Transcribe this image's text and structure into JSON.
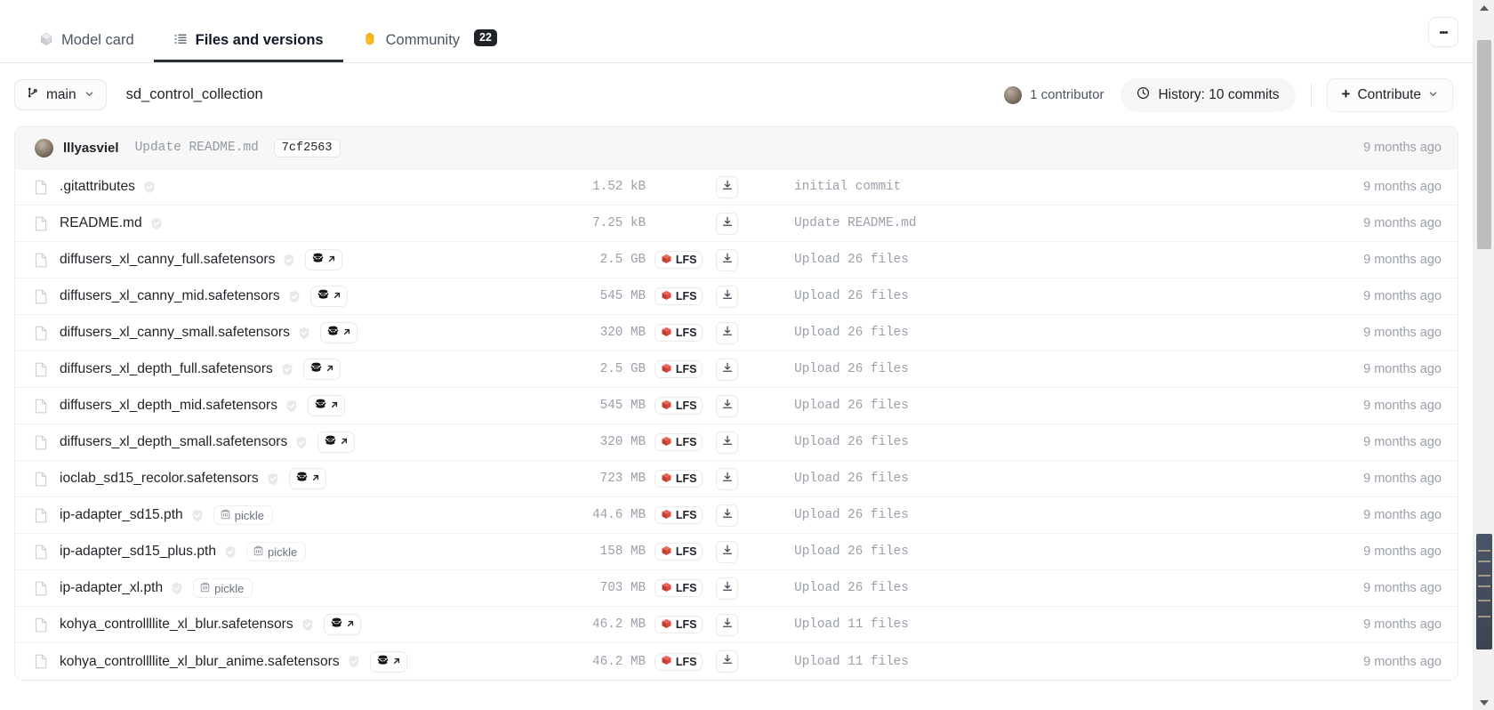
{
  "tabs": [
    {
      "label": "Model card",
      "icon": "cube-icon",
      "active": false,
      "badge": null
    },
    {
      "label": "Files and versions",
      "icon": "files-list-icon",
      "active": true,
      "badge": null
    },
    {
      "label": "Community",
      "icon": "raised-hand-icon",
      "active": false,
      "badge": "22"
    }
  ],
  "overflow_menu": "kebab-menu",
  "toolbar": {
    "branch": "main",
    "repo_name": "sd_control_collection",
    "contributor_text": "1 contributor",
    "history_text": "History: 10 commits",
    "contribute_text": "Contribute",
    "contribute_plus": "+"
  },
  "commit_bar": {
    "author": "lllyasviel",
    "message": "Update README.md",
    "hash": "7cf2563",
    "time": "9 months ago"
  },
  "colors": {
    "lfs_red": "#d94c3d",
    "tab_active_underline": "#2b2f36",
    "badge_dark": "#1f2328",
    "muted_text": "#9aa0aa"
  },
  "files": [
    {
      "name": ".gitattributes",
      "safe": true,
      "badge": null,
      "size": "1.52 kB",
      "lfs": false,
      "message": "initial commit",
      "time": "9 months ago"
    },
    {
      "name": "README.md",
      "safe": true,
      "badge": null,
      "size": "7.25 kB",
      "lfs": false,
      "message": "Update README.md",
      "time": "9 months ago"
    },
    {
      "name": "diffusers_xl_canny_full.safetensors",
      "safe": true,
      "badge": "safetensors",
      "size": "2.5 GB",
      "lfs": true,
      "message": "Upload 26 files",
      "time": "9 months ago"
    },
    {
      "name": "diffusers_xl_canny_mid.safetensors",
      "safe": true,
      "badge": "safetensors",
      "size": "545 MB",
      "lfs": true,
      "message": "Upload 26 files",
      "time": "9 months ago"
    },
    {
      "name": "diffusers_xl_canny_small.safetensors",
      "safe": true,
      "badge": "safetensors",
      "size": "320 MB",
      "lfs": true,
      "message": "Upload 26 files",
      "time": "9 months ago"
    },
    {
      "name": "diffusers_xl_depth_full.safetensors",
      "safe": true,
      "badge": "safetensors",
      "size": "2.5 GB",
      "lfs": true,
      "message": "Upload 26 files",
      "time": "9 months ago"
    },
    {
      "name": "diffusers_xl_depth_mid.safetensors",
      "safe": true,
      "badge": "safetensors",
      "size": "545 MB",
      "lfs": true,
      "message": "Upload 26 files",
      "time": "9 months ago"
    },
    {
      "name": "diffusers_xl_depth_small.safetensors",
      "safe": true,
      "badge": "safetensors",
      "size": "320 MB",
      "lfs": true,
      "message": "Upload 26 files",
      "time": "9 months ago"
    },
    {
      "name": "ioclab_sd15_recolor.safetensors",
      "safe": true,
      "badge": "safetensors",
      "size": "723 MB",
      "lfs": true,
      "message": "Upload 26 files",
      "time": "9 months ago"
    },
    {
      "name": "ip-adapter_sd15.pth",
      "safe": true,
      "badge": "pickle",
      "size": "44.6 MB",
      "lfs": true,
      "message": "Upload 26 files",
      "time": "9 months ago"
    },
    {
      "name": "ip-adapter_sd15_plus.pth",
      "safe": true,
      "badge": "pickle",
      "size": "158 MB",
      "lfs": true,
      "message": "Upload 26 files",
      "time": "9 months ago"
    },
    {
      "name": "ip-adapter_xl.pth",
      "safe": true,
      "badge": "pickle",
      "size": "703 MB",
      "lfs": true,
      "message": "Upload 26 files",
      "time": "9 months ago"
    },
    {
      "name": "kohya_controllllite_xl_blur.safetensors",
      "safe": true,
      "badge": "safetensors",
      "size": "46.2 MB",
      "lfs": true,
      "message": "Upload 11 files",
      "time": "9 months ago"
    },
    {
      "name": "kohya_controllllite_xl_blur_anime.safetensors",
      "safe": true,
      "badge": "safetensors",
      "size": "46.2 MB",
      "lfs": true,
      "message": "Upload 11 files",
      "time": "9 months ago"
    }
  ],
  "badge_labels": {
    "lfs": "LFS",
    "pickle": "pickle"
  }
}
